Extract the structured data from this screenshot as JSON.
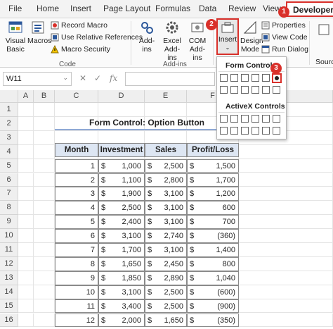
{
  "tabs": [
    {
      "label": "File"
    },
    {
      "label": "Home"
    },
    {
      "label": "Insert"
    },
    {
      "label": "Page Layout"
    },
    {
      "label": "Formulas"
    },
    {
      "label": "Data"
    },
    {
      "label": "Review"
    },
    {
      "label": "View"
    },
    {
      "label": "Developer"
    }
  ],
  "badges": {
    "one": "1",
    "two": "2",
    "three": "3"
  },
  "ribbon": {
    "visual_basic": "Visual Basic",
    "macros": "Macros",
    "record_macro": "Record Macro",
    "relative_refs": "Use Relative References",
    "macro_security": "Macro Security",
    "group_code": "Code",
    "addins": "Add-ins",
    "excel_addins": "Excel Add-ins",
    "com_addins": "COM Add-ins",
    "group_addins": "Add-ins",
    "insert": "Insert",
    "design_mode": "Design Mode",
    "properties": "Properties",
    "view_code": "View Code",
    "run_dialog": "Run Dialog",
    "source": "Source"
  },
  "dropdown": {
    "form_controls": "Form Controls",
    "activex_controls": "ActiveX Controls"
  },
  "formula_bar": {
    "name_box": "W11",
    "fx": "fx"
  },
  "columns": [
    "A",
    "B",
    "C",
    "D",
    "E",
    "F"
  ],
  "rows": [
    "1",
    "2",
    "3",
    "4",
    "5",
    "6",
    "7",
    "8",
    "9",
    "10",
    "11",
    "12",
    "13",
    "14",
    "15",
    "16"
  ],
  "sheet": {
    "title": "Form Control: Option Button",
    "headers": [
      "Month",
      "Investment",
      "Sales",
      "Profit/Loss"
    ],
    "currency": "$",
    "data": [
      [
        "1",
        "1,000",
        "2,500",
        "1,500"
      ],
      [
        "2",
        "1,100",
        "2,800",
        "1,700"
      ],
      [
        "3",
        "1,900",
        "3,100",
        "1,200"
      ],
      [
        "4",
        "2,500",
        "3,100",
        "600"
      ],
      [
        "5",
        "2,400",
        "3,100",
        "700"
      ],
      [
        "6",
        "3,100",
        "2,740",
        "(360)"
      ],
      [
        "7",
        "1,700",
        "3,100",
        "1,400"
      ],
      [
        "8",
        "1,650",
        "2,450",
        "800"
      ],
      [
        "9",
        "1,850",
        "2,890",
        "1,040"
      ],
      [
        "10",
        "3,100",
        "2,500",
        "(600)"
      ],
      [
        "11",
        "3,400",
        "2,500",
        "(900)"
      ],
      [
        "12",
        "2,000",
        "1,650",
        "(350)"
      ]
    ]
  },
  "colors": {
    "accent_red": "#d9302a",
    "header_fill": "#dde6f3",
    "excel_green": "#217346"
  }
}
